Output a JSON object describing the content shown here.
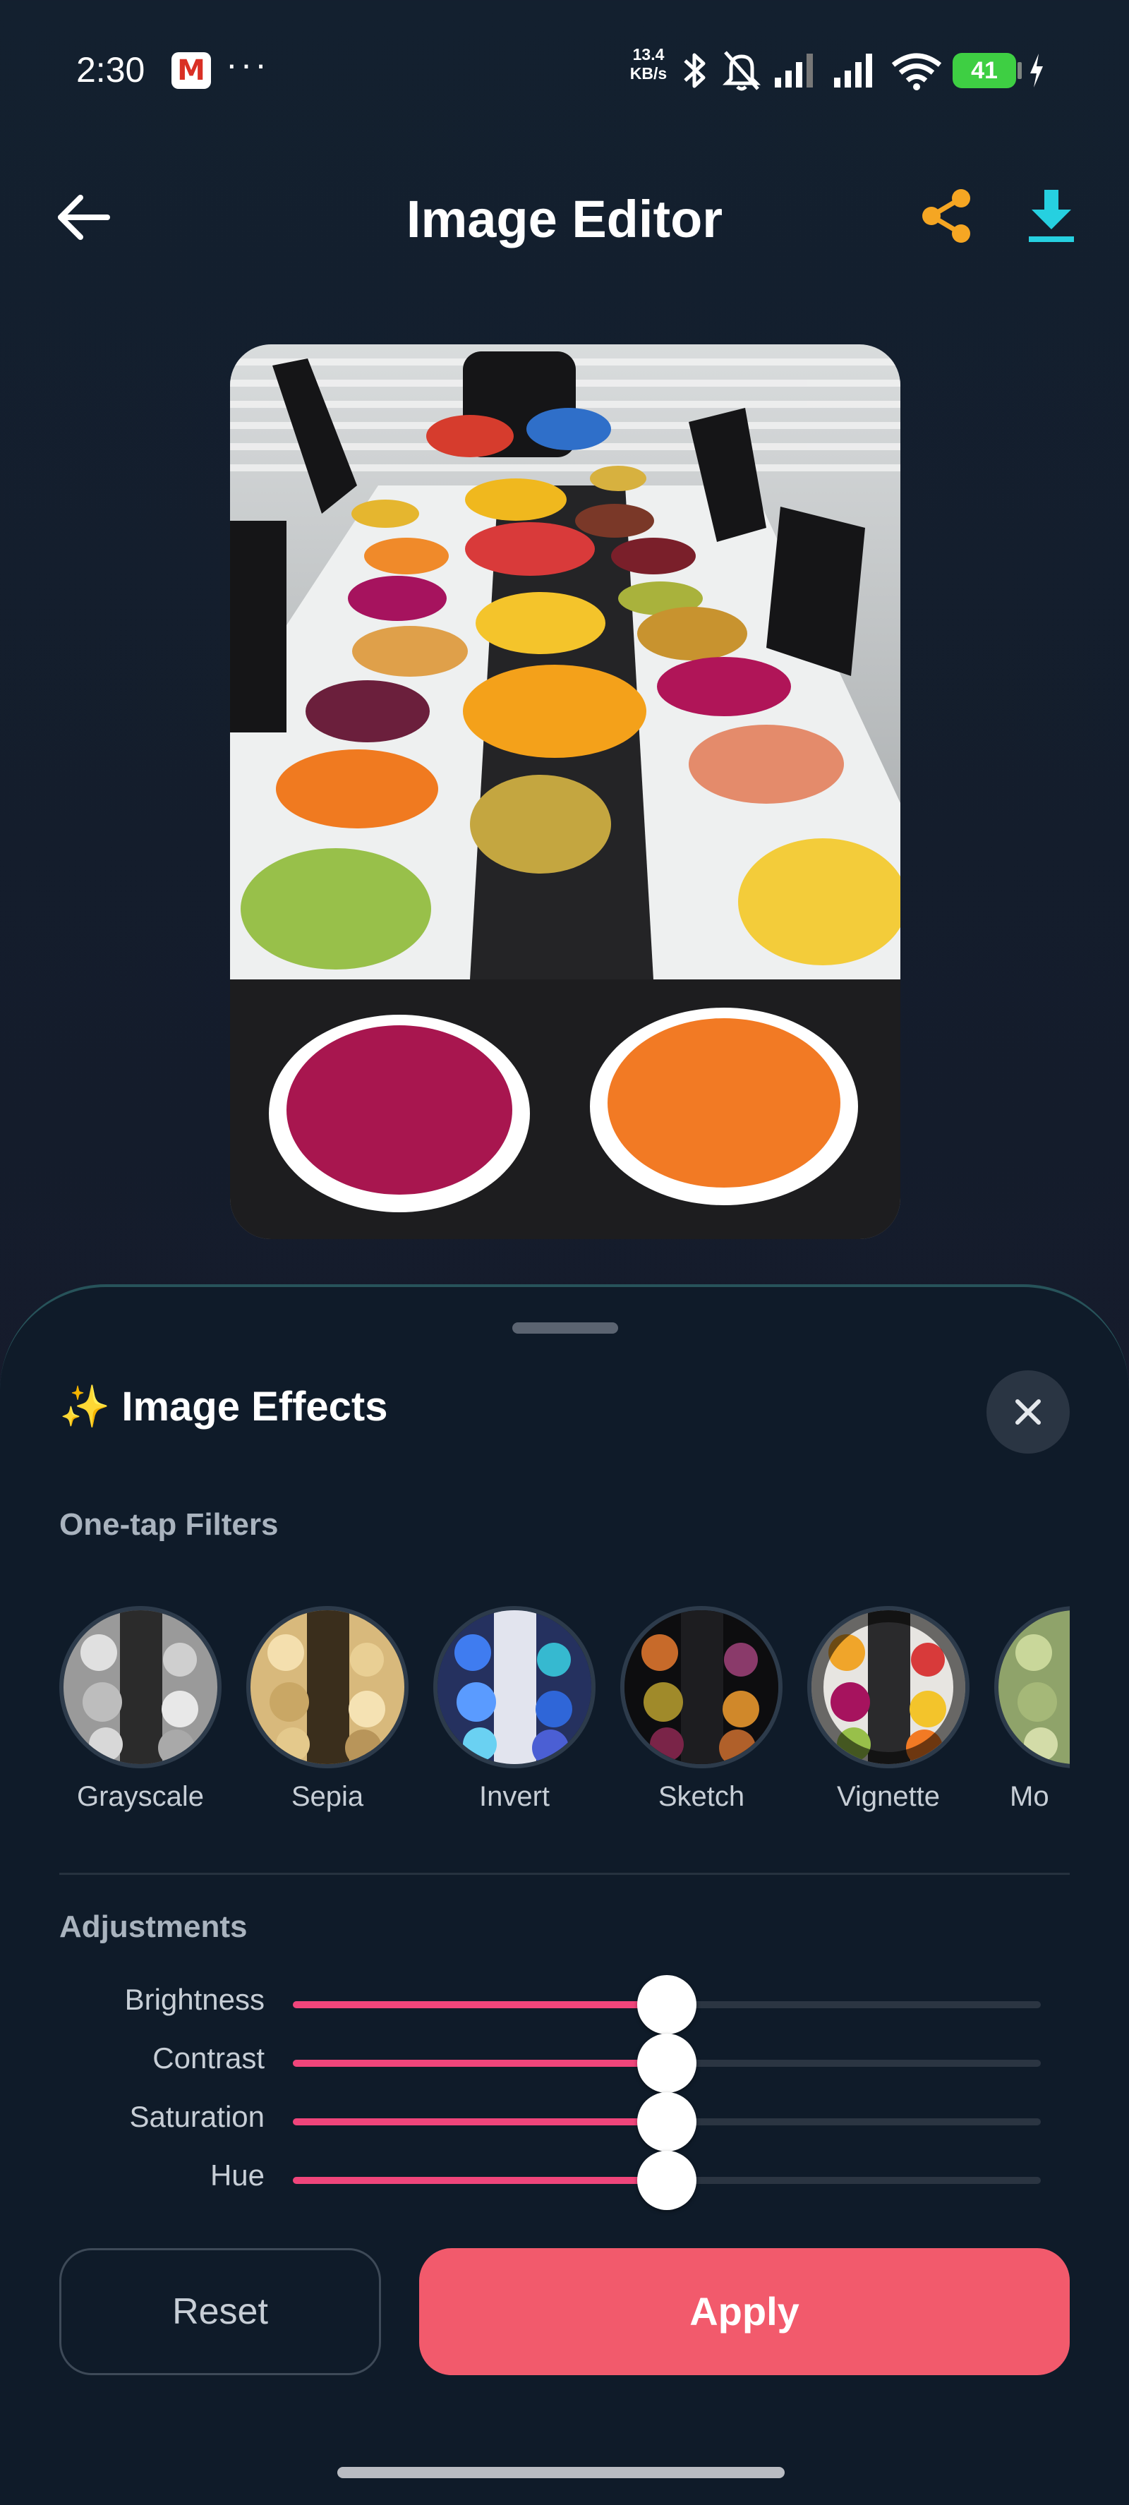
{
  "status_bar": {
    "time": "2:30",
    "app_icon": "gmail-icon",
    "more": "···",
    "net_speed_value": "13.4",
    "net_speed_unit": "KB/s",
    "icons": [
      "bluetooth-icon",
      "mute-bell-icon",
      "signal-icon",
      "signal-icon",
      "wifi-icon"
    ],
    "battery": "41",
    "charging": true
  },
  "header": {
    "title": "Image Editor",
    "back_icon": "back-arrow-icon",
    "share_icon": "share-icon",
    "download_icon": "download-icon",
    "accent_share": "#f5a623",
    "accent_download": "#26d0e0"
  },
  "photo": {
    "description_icon": "photo-fruit-table"
  },
  "sheet": {
    "emoji": "✨",
    "title": "Image Effects",
    "close_icon": "close-icon",
    "filters_label": "One-tap Filters",
    "filters": [
      {
        "label": "Grayscale"
      },
      {
        "label": "Sepia"
      },
      {
        "label": "Invert"
      },
      {
        "label": "Sketch"
      },
      {
        "label": "Vignette"
      },
      {
        "label": "Mo"
      }
    ],
    "adjustments_label": "Adjustments",
    "adjustments": [
      {
        "label": "Brightness",
        "value": 0.5
      },
      {
        "label": "Contrast",
        "value": 0.5
      },
      {
        "label": "Saturation",
        "value": 0.5
      },
      {
        "label": "Hue",
        "value": 0.5
      }
    ],
    "reset_label": "Reset",
    "apply_label": "Apply",
    "accent": "#f25a6c",
    "slider_color": "#f0457b"
  }
}
